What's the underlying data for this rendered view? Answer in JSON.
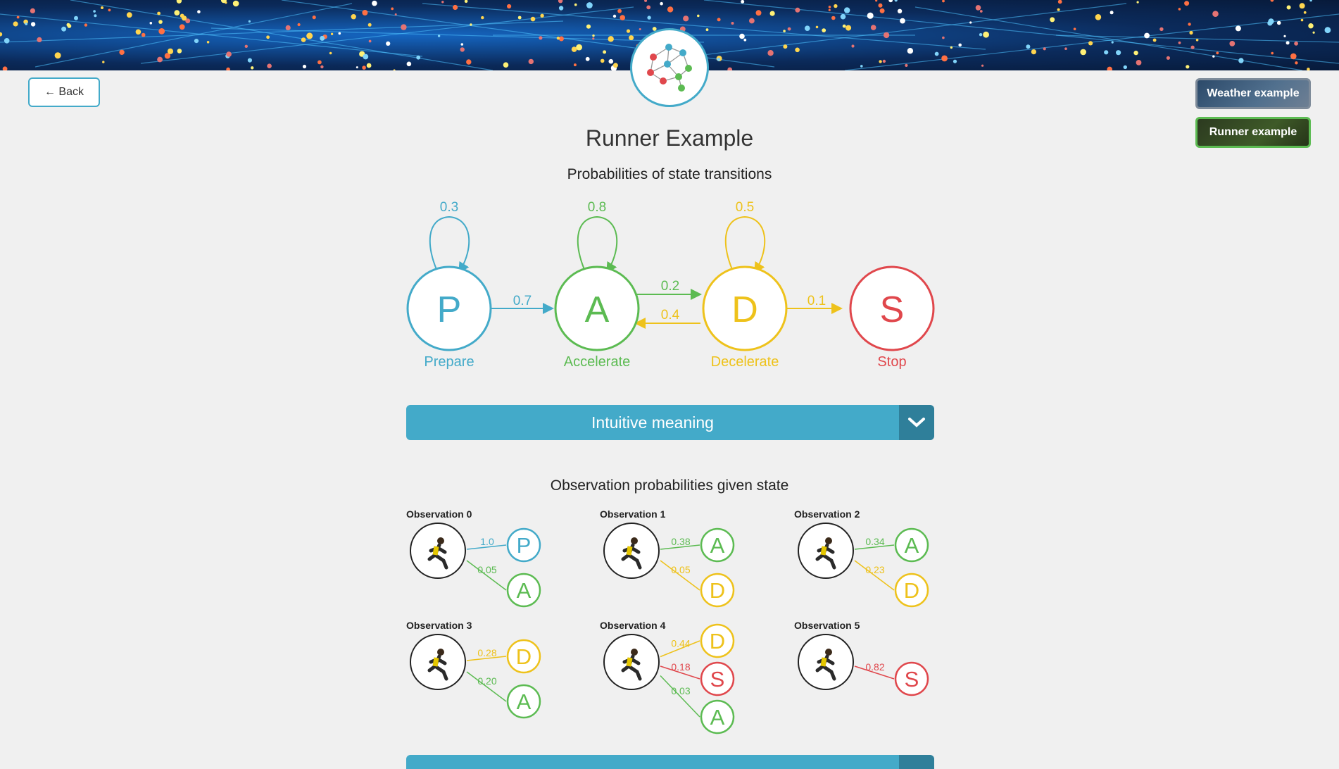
{
  "header": {
    "logo_icon": "neural-network-logo-icon"
  },
  "nav": {
    "back_label": "← Back",
    "weather_label": "Weather example",
    "runner_label": "Runner example"
  },
  "page_title": "Runner Example",
  "transitions": {
    "title": "Probabilities of state transitions",
    "states": [
      {
        "letter": "P",
        "name": "Prepare",
        "color": "#43aac9"
      },
      {
        "letter": "A",
        "name": "Accelerate",
        "color": "#5cbb52"
      },
      {
        "letter": "D",
        "name": "Decelerate",
        "color": "#eec21b"
      },
      {
        "letter": "S",
        "name": "Stop",
        "color": "#e0474c"
      }
    ],
    "self_loops": [
      "0.3",
      "0.8",
      "0.5"
    ],
    "edges": {
      "p_to_a": "0.7",
      "a_to_d": "0.2",
      "d_to_a": "0.4",
      "d_to_s": "0.1"
    }
  },
  "accordion": {
    "label": "Intuitive meaning",
    "icon": "chevron-down-icon"
  },
  "observations": {
    "title": "Observation probabilities given state",
    "items": [
      {
        "title": "Observation 0",
        "links": [
          {
            "state": "P",
            "prob": "1.0"
          },
          {
            "state": "A",
            "prob": "0.05"
          }
        ]
      },
      {
        "title": "Observation 1",
        "links": [
          {
            "state": "A",
            "prob": "0.38"
          },
          {
            "state": "D",
            "prob": "0.05"
          }
        ]
      },
      {
        "title": "Observation 2",
        "links": [
          {
            "state": "A",
            "prob": "0.34"
          },
          {
            "state": "D",
            "prob": "0.23"
          }
        ]
      },
      {
        "title": "Observation 3",
        "links": [
          {
            "state": "D",
            "prob": "0.28"
          },
          {
            "state": "A",
            "prob": "0.20"
          }
        ]
      },
      {
        "title": "Observation 4",
        "links": [
          {
            "state": "D",
            "prob": "0.44"
          },
          {
            "state": "S",
            "prob": "0.18"
          },
          {
            "state": "A",
            "prob": "0.03"
          }
        ]
      },
      {
        "title": "Observation 5",
        "links": [
          {
            "state": "S",
            "prob": "0.82"
          }
        ]
      }
    ]
  }
}
